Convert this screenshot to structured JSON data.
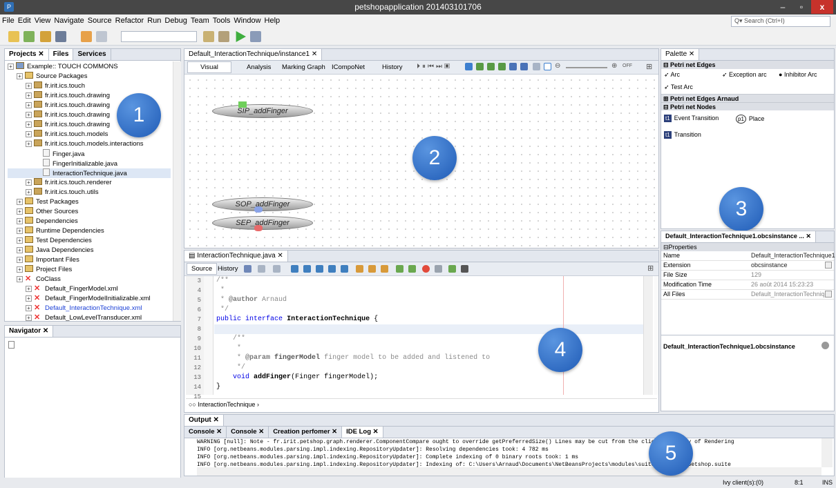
{
  "window": {
    "title": "petshopapplication 201403101706",
    "app_icon": "P"
  },
  "window_controls": {
    "minimize": "–",
    "maximize": "▫",
    "close": "x"
  },
  "menu": [
    "File",
    "Edit",
    "View",
    "Navigate",
    "Source",
    "Refactor",
    "Run",
    "Debug",
    "Team",
    "Tools",
    "Window",
    "Help"
  ],
  "search": {
    "placeholder": "Search (Ctrl+I)"
  },
  "projects": {
    "tabs": [
      "Projects",
      "Files",
      "Services"
    ],
    "tree": [
      {
        "label": "Example:: TOUCH COMMONS",
        "indent": 0,
        "icon": "project"
      },
      {
        "label": "Source Packages",
        "indent": 1,
        "icon": "folder"
      },
      {
        "label": "fr.irit.ics.touch",
        "indent": 2,
        "icon": "package"
      },
      {
        "label": "fr.irit.ics.touch.drawing",
        "indent": 2,
        "icon": "package"
      },
      {
        "label": "fr.irit.ics.touch.drawing",
        "indent": 2,
        "icon": "package"
      },
      {
        "label": "fr.irit.ics.touch.drawing",
        "indent": 2,
        "icon": "package"
      },
      {
        "label": "fr.irit.ics.touch.drawing",
        "indent": 2,
        "icon": "package"
      },
      {
        "label": "fr.irit.ics.touch.models",
        "indent": 2,
        "icon": "package"
      },
      {
        "label": "fr.irit.ics.touch.models.interactions",
        "indent": 2,
        "icon": "package"
      },
      {
        "label": "Finger.java",
        "indent": 3,
        "icon": "java"
      },
      {
        "label": "FingerInitializable.java",
        "indent": 3,
        "icon": "java"
      },
      {
        "label": "InteractionTechnique.java",
        "indent": 3,
        "icon": "java",
        "selected": true
      },
      {
        "label": "fr.irit.ics.touch.renderer",
        "indent": 2,
        "icon": "package"
      },
      {
        "label": "fr.irit.ics.touch.utils",
        "indent": 2,
        "icon": "package"
      },
      {
        "label": "Test Packages",
        "indent": 1,
        "icon": "folder"
      },
      {
        "label": "Other Sources",
        "indent": 1,
        "icon": "folder"
      },
      {
        "label": "Dependencies",
        "indent": 1,
        "icon": "folder"
      },
      {
        "label": "Runtime Dependencies",
        "indent": 1,
        "icon": "folder"
      },
      {
        "label": "Test Dependencies",
        "indent": 1,
        "icon": "folder"
      },
      {
        "label": "Java Dependencies",
        "indent": 1,
        "icon": "folder"
      },
      {
        "label": "Important Files",
        "indent": 1,
        "icon": "folder"
      },
      {
        "label": "Project Files",
        "indent": 1,
        "icon": "folder"
      },
      {
        "label": "CoClass",
        "indent": 1,
        "icon": "coclass"
      },
      {
        "label": "Default_FingerModel.xml",
        "indent": 2,
        "icon": "xml"
      },
      {
        "label": "Default_FingerModelInitializable.xml",
        "indent": 2,
        "icon": "xml"
      },
      {
        "label": "Default_InteractionTechnique.xml",
        "indent": 2,
        "icon": "xml",
        "link": true
      },
      {
        "label": "Default_LowLevelTransducer.xml",
        "indent": 2,
        "icon": "xml"
      }
    ]
  },
  "navigator": {
    "title": "Navigator"
  },
  "model_editor": {
    "tab": "Default_InteractionTechnique/instance1",
    "tabs": [
      "Visual",
      "Analysis",
      "Marking Graph",
      "ICompoNet",
      "History"
    ],
    "zoom_off": "OFF",
    "transitions": [
      "SIP_addFinger",
      "SOP_addFinger",
      "SEP_addFinger"
    ]
  },
  "palette": {
    "title": "Palette",
    "sections": [
      {
        "name": "Petri net Edges",
        "open": true,
        "items": [
          "Arc",
          "Exception arc",
          "Inhibitor Arc",
          "Test Arc"
        ]
      },
      {
        "name": "Petri net Edges Arnaud",
        "open": false,
        "items": []
      },
      {
        "name": "Petri net Nodes",
        "open": true,
        "items": [
          "Event Transition",
          "Place",
          "Transition"
        ]
      }
    ]
  },
  "properties": {
    "title": "Default_InteractionTechnique1.obcsinstance ...",
    "section": "Properties",
    "rows": [
      {
        "k": "Name",
        "v": "Default_InteractionTechnique1"
      },
      {
        "k": "Extension",
        "v": "obcsinstance"
      },
      {
        "k": "File Size",
        "v": "129"
      },
      {
        "k": "Modification Time",
        "v": "26 août 2014 15:23:23"
      },
      {
        "k": "All Files",
        "v": "Default_InteractionTechniq..."
      }
    ],
    "footer": "Default_InteractionTechnique1.obcsinstance"
  },
  "code_editor": {
    "tab": "InteractionTechnique.java",
    "tabs": [
      "Source",
      "History"
    ],
    "lines": [
      {
        "n": "3",
        "t": "/**"
      },
      {
        "n": "4",
        "t": " *"
      },
      {
        "n": "5",
        "t": " * @author Arnaud"
      },
      {
        "n": "6",
        "t": " */"
      },
      {
        "n": "7",
        "t": "public interface InteractionTechnique {"
      },
      {
        "n": "8",
        "t": ""
      },
      {
        "n": "9",
        "t": "    /**"
      },
      {
        "n": "10",
        "t": "     *"
      },
      {
        "n": "11",
        "t": "     * @param fingerModel finger model to be added and listened to"
      },
      {
        "n": "12",
        "t": "     */"
      },
      {
        "n": "13",
        "t": "    void addFinger(Finger fingerModel);"
      },
      {
        "n": "14",
        "t": "}"
      },
      {
        "n": "15",
        "t": ""
      }
    ],
    "breadcrumb": "InteractionTechnique"
  },
  "output": {
    "title": "Output",
    "tabs": [
      "Console",
      "Console",
      "Creation perfomer",
      "IDE Log"
    ],
    "lines": [
      "WARNING [null]: Note - fr.irit.petshop.graph.renderer.ComponentCompare ought to override getPreferredSize() Lines may be cut from the client property of Rendering",
      "INFO [org.netbeans.modules.parsing.impl.indexing.RepositoryUpdater]: Resolving dependencies took: 4 782 ms",
      "INFO [org.netbeans.modules.parsing.impl.indexing.RepositoryUpdater]: Complete indexing of 0 binary roots took: 1 ms",
      "INFO [org.netbeans.modules.parsing.impl.indexing.RepositoryUpdater]: Indexing of: C:\\Users\\Arnaud\\Documents\\NetBeansProjects\\modules\\suites\\petshop\\petshop.suite"
    ]
  },
  "status": {
    "ivy": "Ivy client(s):(0)",
    "pos": "8:1",
    "mode": "INS"
  },
  "annotations": [
    "1",
    "2",
    "3",
    "4",
    "5"
  ],
  "colors": {
    "accent": "#2f6fb5",
    "titlebar": "#474747",
    "close": "#c7322b"
  }
}
